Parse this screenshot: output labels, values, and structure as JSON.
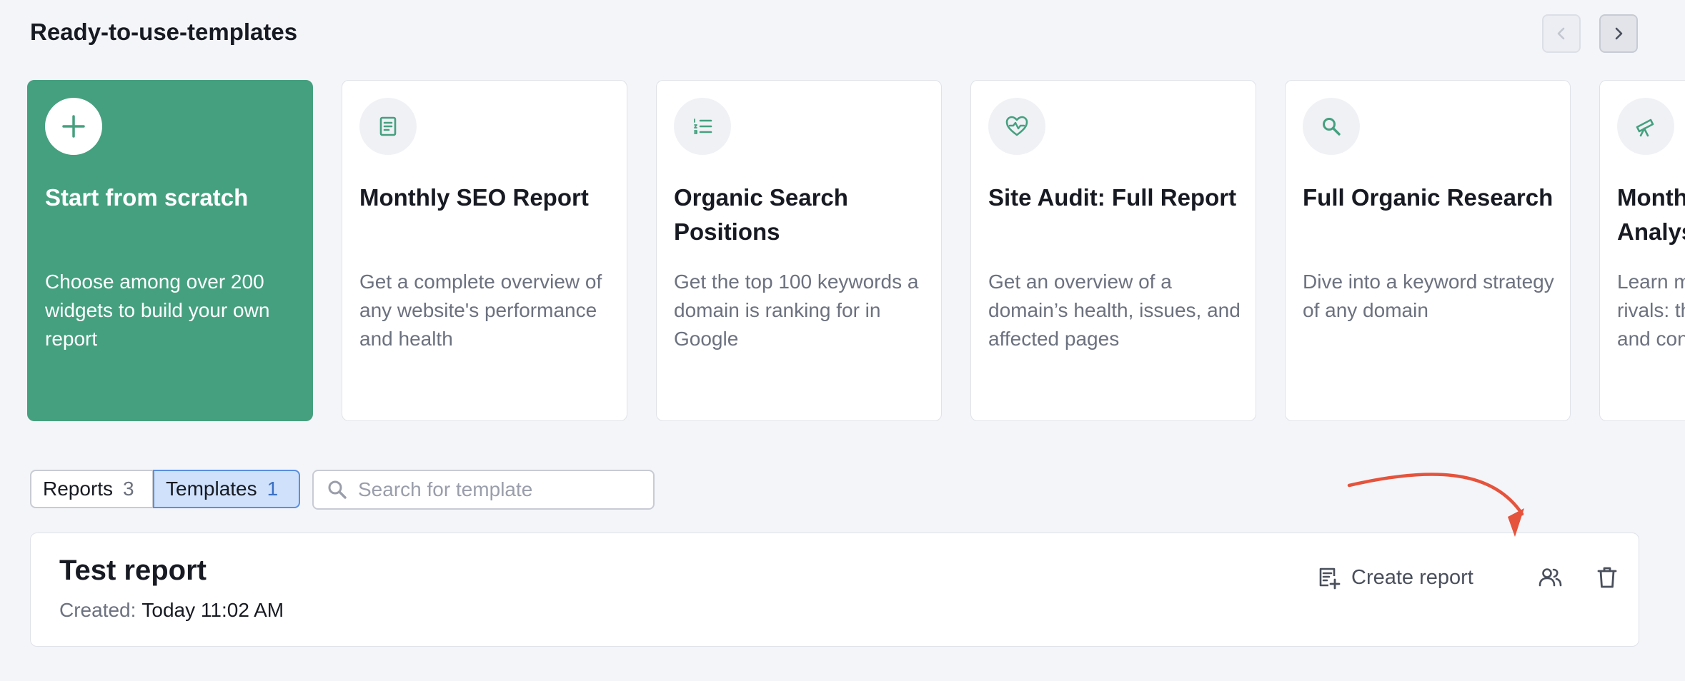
{
  "header": {
    "title": "Ready-to-use-templates"
  },
  "cards": [
    {
      "icon": "plus-icon",
      "title": "Start from scratch",
      "desc": "Choose among over 200 widgets to build your own report"
    },
    {
      "icon": "document-icon",
      "title": "Monthly SEO Report",
      "desc": "Get a complete overview of any website's performance and health"
    },
    {
      "icon": "list-icon",
      "title": "Organic Search Positions",
      "desc": "Get the top 100 keywords a domain is ranking for in Google"
    },
    {
      "icon": "heart-pulse-icon",
      "title": "Site Audit: Full Report",
      "desc": "Get an overview of a domain’s health, issues, and affected pages"
    },
    {
      "icon": "search-icon",
      "title": "Full Organic Research",
      "desc": "Dive into a keyword strategy of any domain"
    },
    {
      "icon": "telescope-icon",
      "title": "Monthly Competitor Analysis",
      "desc": "Learn more about your rivals: their traffic, keywords, and content"
    }
  ],
  "tabs": {
    "reports_label": "Reports",
    "reports_count": "3",
    "templates_label": "Templates",
    "templates_count": "1"
  },
  "search": {
    "placeholder": "Search for template"
  },
  "report": {
    "title": "Test report",
    "created_label": "Created:",
    "created_value": "Today 11:02 AM",
    "create_label": "Create report"
  },
  "colors": {
    "accent_green": "#45a07f",
    "annotation_arrow": "#e5533c",
    "selected_tab_bg": "#cfe1fb"
  }
}
